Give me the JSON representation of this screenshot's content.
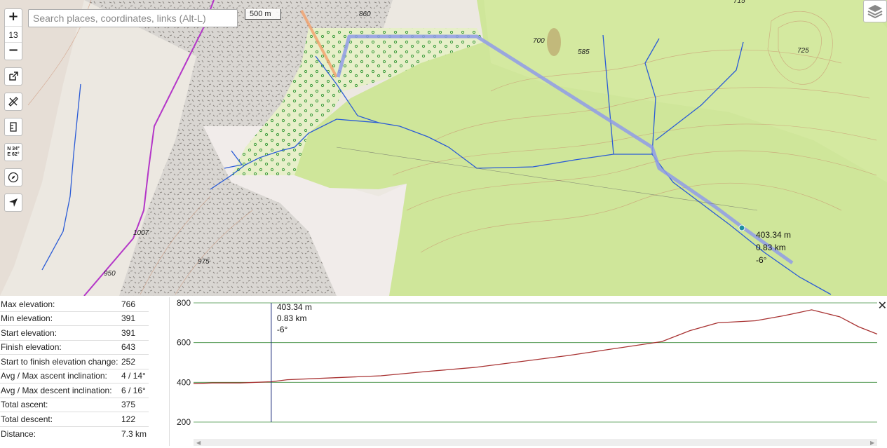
{
  "search": {
    "placeholder": "Search places, coordinates, links (Alt-L)"
  },
  "zoom": {
    "in_label": "+",
    "level": "13",
    "out_label": "−"
  },
  "scale": {
    "label": "500 m"
  },
  "coords_button": {
    "line1": "N 34°",
    "line2": "E 62°"
  },
  "map_labels": {
    "peak_860": "860",
    "peak_715": "715",
    "peak_700": "700",
    "peak_585": "585",
    "peak_725": "725",
    "peak_1007": "1007",
    "peak_975": "975",
    "contour_950": "950"
  },
  "map_tooltip": {
    "elevation": "403.34 m",
    "distance": "0.83 km",
    "angle": "-6°"
  },
  "stats": [
    {
      "label": "Max elevation:",
      "value": "766"
    },
    {
      "label": "Min elevation:",
      "value": "391"
    },
    {
      "label": "Start elevation:",
      "value": "391"
    },
    {
      "label": "Finish elevation:",
      "value": "643"
    },
    {
      "label": "Start to finish elevation change:",
      "value": "252"
    },
    {
      "label": "Avg / Max ascent inclination:",
      "value": "4 / 14°"
    },
    {
      "label": "Avg / Max descent inclination:",
      "value": "6 / 16°"
    },
    {
      "label": "Total ascent:",
      "value": "375"
    },
    {
      "label": "Total descent:",
      "value": "122"
    },
    {
      "label": "Distance:",
      "value": "7.3 km"
    }
  ],
  "chart_close": "✕",
  "colors": {
    "line": "#a83232",
    "grid": "#3c8c3c",
    "cursor": "#1a2a7a",
    "route": "#8f9be8",
    "water": "#2a5bd6",
    "boundary": "#b436c8"
  },
  "chart_data": {
    "type": "line",
    "x": [
      0,
      0.2,
      0.5,
      0.83,
      1.0,
      1.5,
      2.0,
      2.5,
      3.0,
      3.5,
      4.0,
      4.5,
      5.0,
      5.3,
      5.6,
      6.0,
      6.3,
      6.6,
      6.9,
      7.1,
      7.3
    ],
    "series": [
      {
        "values": [
          393,
          397,
          397,
          403,
          413,
          423,
          433,
          455,
          475,
          505,
          535,
          570,
          605,
          660,
          700,
          710,
          735,
          765,
          730,
          680,
          643
        ]
      }
    ],
    "ylim": [
      200,
      800
    ],
    "yticks": [
      "200",
      "400",
      "600",
      "800"
    ],
    "xlim": [
      0,
      7.3
    ],
    "grid": true,
    "cursor": {
      "x": 0.83,
      "label_elevation": "403.34 m",
      "label_distance": "0.83 km",
      "label_angle": "-6°"
    }
  }
}
